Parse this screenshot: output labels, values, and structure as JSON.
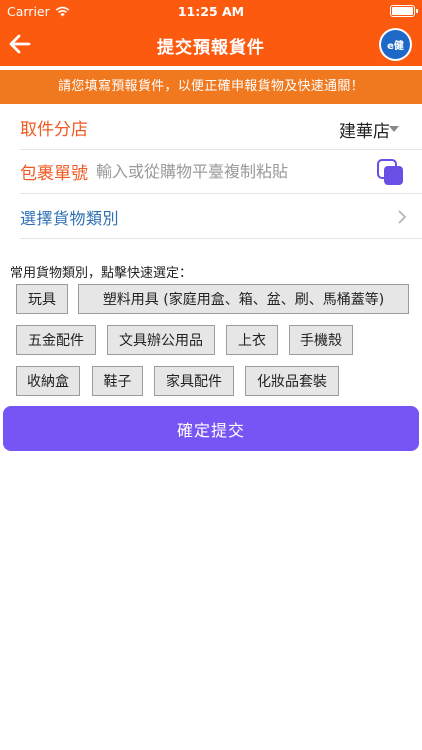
{
  "status_bar": {
    "carrier": "Carrier",
    "time": "11:25 AM"
  },
  "nav": {
    "title": "提交預報貨件",
    "logo_text": "e健"
  },
  "notice": "請您填寫預報貨件，以便正確申報貨物及快速通關！",
  "store": {
    "label": "取件分店",
    "value": "建華店"
  },
  "parcel": {
    "label": "包裹單號",
    "placeholder": "輸入或從購物平臺複制粘貼"
  },
  "category": {
    "label": "選擇貨物類別"
  },
  "quick_select": {
    "hint": "常用貨物類別，點擊快速選定：",
    "chips": [
      "玩具",
      "塑料用具 (家庭用盒、箱、盆、刷、馬桶蓋等)",
      "五金配件",
      "文具辦公用品",
      "上衣",
      "手機殼",
      "收納盒",
      "鞋子",
      "家具配件",
      "化妝品套裝"
    ]
  },
  "submit_label": "確定提交",
  "colors": {
    "brand_orange": "#fb5a0f",
    "notice_orange": "#f0781f",
    "label_orange": "#f05a22",
    "link_blue": "#2f6fb3",
    "submit_purple": "#7755f5",
    "copy_icon_purple": "#6a4fe6"
  }
}
